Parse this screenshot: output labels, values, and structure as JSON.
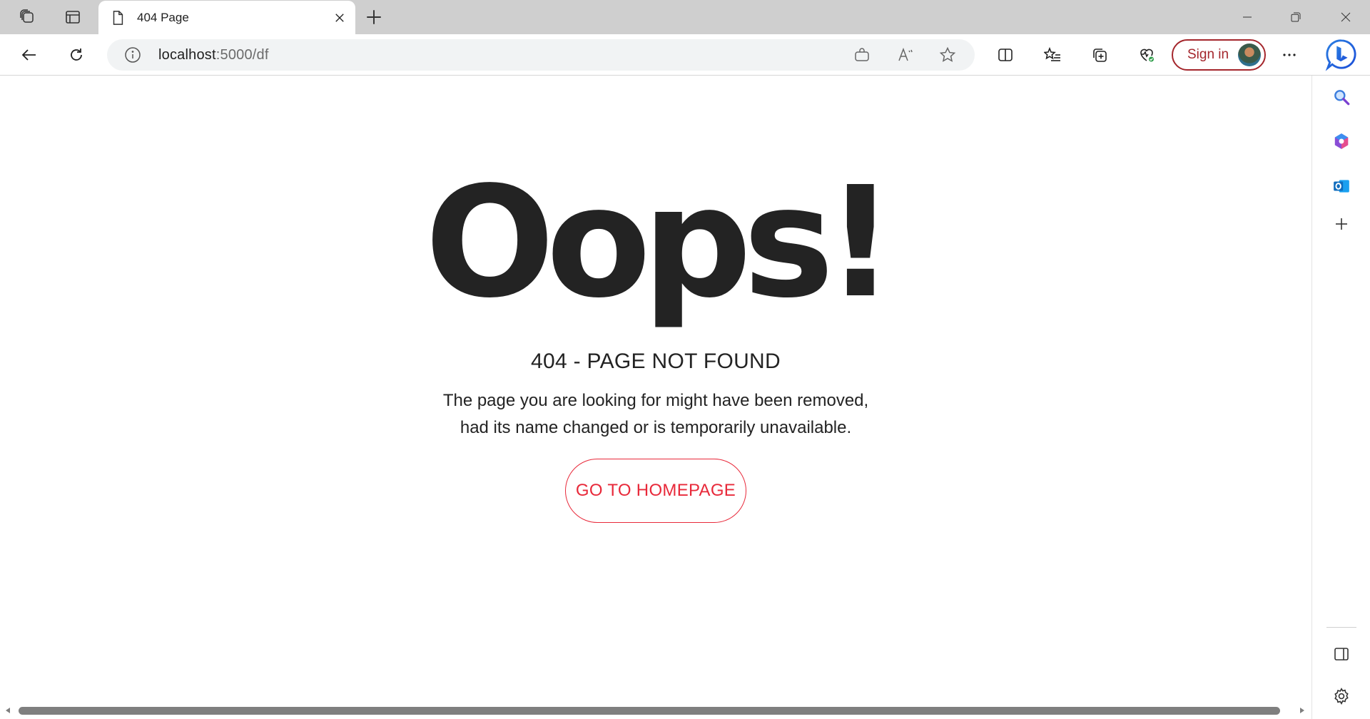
{
  "browser": {
    "tab": {
      "title": "404 Page",
      "favicon": "page-icon"
    },
    "address": {
      "host": "localhost",
      "path": ":5000/df"
    },
    "toolbar": {
      "sign_in_label": "Sign in"
    },
    "icons": {
      "workspaces": "workspaces-icon",
      "vertical_tabs": "tab-actions-icon",
      "new_tab": "plus-icon",
      "back": "back-arrow-icon",
      "refresh": "refresh-icon",
      "site_info": "info-icon",
      "shopping": "shopping-bag-icon",
      "read_aloud": "read-aloud-icon",
      "favorite": "star-icon",
      "split_screen": "split-screen-icon",
      "favorites": "favorites-list-icon",
      "collections": "collections-icon",
      "browser_essentials": "heart-pulse-icon",
      "more": "more-icon",
      "copilot": "copilot-icon"
    },
    "sidebar": [
      "search-icon",
      "office-icon",
      "outlook-icon",
      "plus-icon",
      "sidebar-toggle-icon",
      "settings-icon"
    ]
  },
  "page": {
    "heading": "Oops!",
    "subtitle": "404 - PAGE NOT FOUND",
    "description_line1": "The page you are looking for might have been removed,",
    "description_line2": "had its name changed or is temporarily unavailable.",
    "home_button_label": "GO TO HOMEPAGE"
  },
  "colors": {
    "accent": "#e8293a",
    "heading_text": "#232323",
    "signin_border": "#a4262c",
    "tabstrip_bg": "#cfcfcf"
  }
}
